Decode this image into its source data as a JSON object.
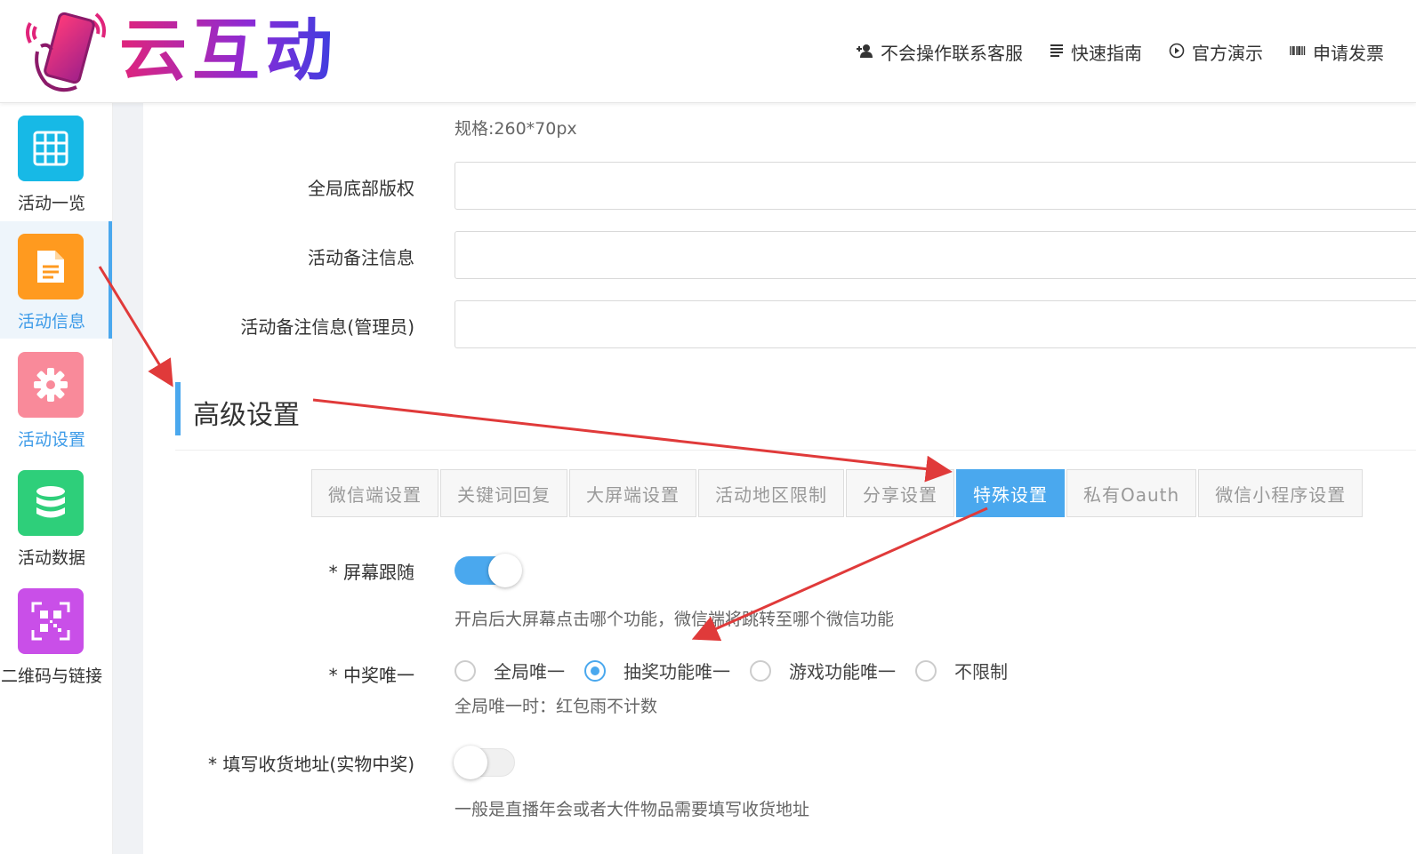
{
  "header": {
    "logo_text": "云互动",
    "nav": [
      {
        "icon": "add-user-icon",
        "label": "不会操作联系客服"
      },
      {
        "icon": "list-icon",
        "label": "快速指南"
      },
      {
        "icon": "play-circle-icon",
        "label": "官方演示"
      },
      {
        "icon": "barcode-icon",
        "label": "申请发票"
      }
    ]
  },
  "sidebar": {
    "items": [
      {
        "label": "活动一览",
        "icon": "grid-icon",
        "color": "#17b9e6"
      },
      {
        "label": "活动信息",
        "icon": "document-icon",
        "color": "#ff9a1f",
        "active": true
      },
      {
        "label": "活动设置",
        "icon": "gear-icon",
        "color": "#f98a9a"
      },
      {
        "label": "活动数据",
        "icon": "database-icon",
        "color": "#2ecf7a"
      },
      {
        "label": "二维码与链接",
        "icon": "qrcode-icon",
        "color": "#c94fe8"
      }
    ]
  },
  "form": {
    "spec_hint": "规格:260*70px",
    "fields": [
      {
        "label": "全局底部版权",
        "value": ""
      },
      {
        "label": "活动备注信息",
        "value": ""
      },
      {
        "label": "活动备注信息(管理员)",
        "value": ""
      }
    ]
  },
  "advanced": {
    "title": "高级设置",
    "tabs": [
      "微信端设置",
      "关键词回复",
      "大屏端设置",
      "活动地区限制",
      "分享设置",
      "特殊设置",
      "私有Oauth",
      "微信小程序设置"
    ],
    "active_tab": "特殊设置",
    "screen_follow": {
      "label": "* 屏幕跟随",
      "on": true,
      "hint": "开启后大屏幕点击哪个功能，微信端将跳转至哪个微信功能"
    },
    "winner_unique": {
      "label": "* 中奖唯一",
      "options": [
        "全局唯一",
        "抽奖功能唯一",
        "游戏功能唯一",
        "不限制"
      ],
      "selected": "抽奖功能唯一",
      "hint": "全局唯一时：红包雨不计数"
    },
    "address": {
      "label": "* 填写收货地址(实物中奖)",
      "on": false,
      "hint": "一般是直播年会或者大件物品需要填写收货地址"
    }
  },
  "colors": {
    "accent": "#4aa8ee",
    "annotation_arrow": "#e03a3a"
  }
}
